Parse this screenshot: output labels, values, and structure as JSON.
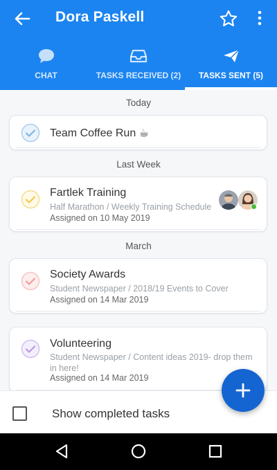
{
  "app_bar": {
    "title": "Dora Paskell",
    "back_icon": "arrow-left-icon",
    "favorite_icon": "star-outline-icon",
    "more_icon": "more-vertical-icon",
    "color": "#1b84f0"
  },
  "tabs": [
    {
      "label": "CHAT",
      "icon": "chat-bubble-icon",
      "active": false
    },
    {
      "label": "TASKS RECEIVED (2)",
      "icon": "inbox-tray-icon",
      "active": false
    },
    {
      "label": "TASKS SENT (5)",
      "icon": "paper-plane-icon",
      "active": true
    }
  ],
  "sections": {
    "today": "Today",
    "last_week": "Last Week",
    "march": "March"
  },
  "tasks": [
    {
      "title": "Team Coffee Run ☕",
      "subtitle": "",
      "assigned": "",
      "check_color": "#7fb6e8"
    },
    {
      "title": "Fartlek Training",
      "subtitle": "Half Marathon / Weekly Training Schedule",
      "assigned": "Assigned on 10 May 2019",
      "check_color": "#f2c94c"
    },
    {
      "title": "Society Awards",
      "subtitle": "Student Newspaper / 2018/19 Events to Cover",
      "assigned": "Assigned on 14 Mar 2019",
      "check_color": "#f29a9a"
    },
    {
      "title": "Volunteering",
      "subtitle": "Student Newspaper / Content ideas 2019- drop them in here!",
      "assigned": "Assigned on 14 Mar 2019",
      "check_color": "#b79ae6"
    }
  ],
  "fab": {
    "icon": "plus-icon",
    "color": "#1465d1"
  },
  "footer": {
    "show_completed_label": "Show completed tasks",
    "checked": false
  },
  "system_nav": {
    "back": "nav-back-icon",
    "home": "nav-home-icon",
    "recents": "nav-recents-icon"
  }
}
